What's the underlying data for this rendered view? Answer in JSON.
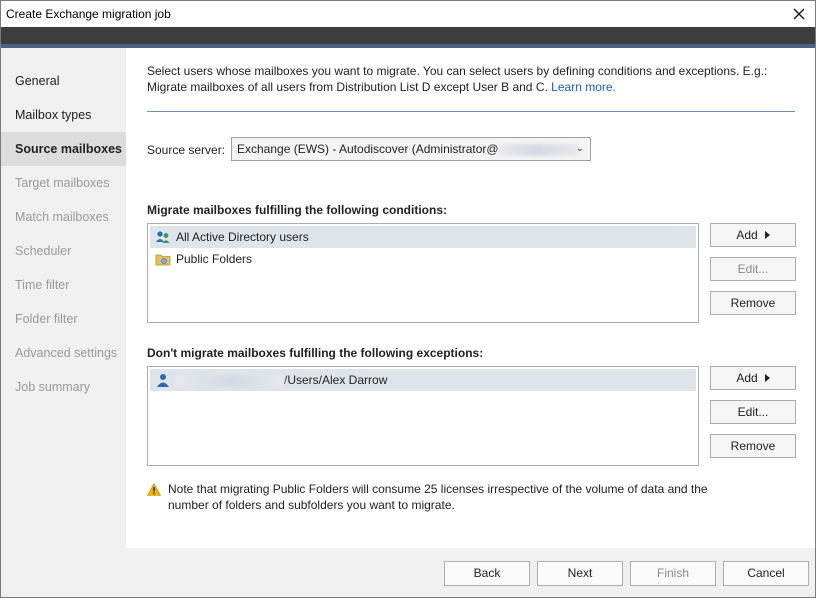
{
  "window": {
    "title": "Create Exchange migration job"
  },
  "sidebar": {
    "items": [
      {
        "label": "General",
        "state": "normal"
      },
      {
        "label": "Mailbox types",
        "state": "normal"
      },
      {
        "label": "Source mailboxes",
        "state": "active"
      },
      {
        "label": "Target mailboxes",
        "state": "disabled"
      },
      {
        "label": "Match mailboxes",
        "state": "disabled"
      },
      {
        "label": "Scheduler",
        "state": "disabled"
      },
      {
        "label": "Time filter",
        "state": "disabled"
      },
      {
        "label": "Folder filter",
        "state": "disabled"
      },
      {
        "label": "Advanced settings",
        "state": "disabled"
      },
      {
        "label": "Job summary",
        "state": "disabled"
      }
    ]
  },
  "main": {
    "intro_text": "Select users whose mailboxes you want to migrate. You can select users by defining conditions and exceptions. E.g.: Migrate mailboxes of all users from Distribution List D except User B and C.",
    "learn_more": "Learn more.",
    "source_server_label": "Source server:",
    "source_server_value": "Exchange (EWS) - Autodiscover (Administrator@",
    "conditions": {
      "title": "Migrate mailboxes fulfilling the following conditions:",
      "items": [
        {
          "label": "All Active Directory users",
          "icon": "users-group-icon",
          "selected": true
        },
        {
          "label": "Public Folders",
          "icon": "public-folder-icon",
          "selected": false
        }
      ],
      "add_label": "Add",
      "edit_label": "Edit...",
      "remove_label": "Remove"
    },
    "exceptions": {
      "title": "Don't migrate mailboxes fulfilling the following exceptions:",
      "items": [
        {
          "label": "/Users/Alex Darrow",
          "icon": "user-icon",
          "selected": true
        }
      ],
      "add_label": "Add",
      "edit_label": "Edit...",
      "remove_label": "Remove"
    },
    "note": "Note that migrating Public Folders will consume 25 licenses irrespective of the volume of data and the number of folders and subfolders you want to migrate."
  },
  "footer": {
    "back": "Back",
    "next": "Next",
    "finish": "Finish",
    "cancel": "Cancel"
  },
  "colors": {
    "accent_link": "#1a5fa8",
    "header_band": "#3d3d3d",
    "accent_band": "#4a6388",
    "selection": "#dfe3ea"
  }
}
